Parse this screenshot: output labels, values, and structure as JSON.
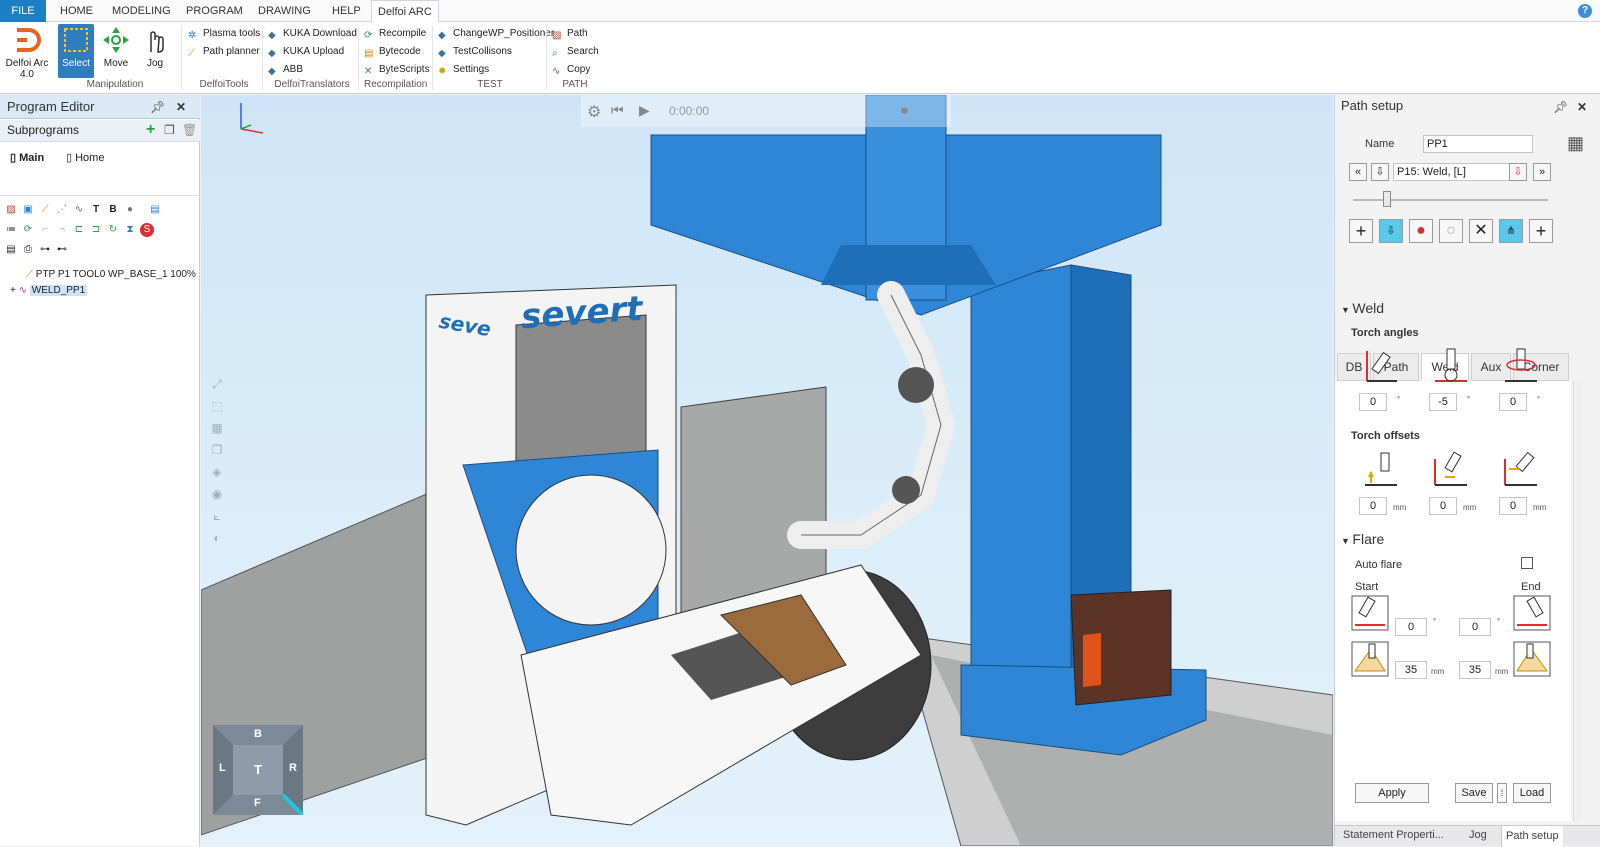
{
  "menu": {
    "file": "FILE",
    "items": [
      "HOME",
      "MODELING",
      "PROGRAM",
      "DRAWING",
      "HELP",
      "Delfoi ARC"
    ]
  },
  "ribbon": {
    "app_name": "Delfoi Arc",
    "app_version": "4.0",
    "select": "Select",
    "move": "Move",
    "jog": "Jog",
    "manipulation": "Manipulation",
    "plasma": "Plasma tools",
    "path_planner": "Path planner",
    "delfoitools": "DelfoiTools",
    "kuka_download": "KUKA Download",
    "kuka_upload": "KUKA Upload",
    "abb": "ABB",
    "delfoitranslators": "DelfoiTranslators",
    "recompile": "Recompile",
    "bytecode": "Bytecode",
    "bytescripts": "ByteScripts",
    "recompilation": "Recompilation",
    "changewp": "ChangeWP_Positioner",
    "testcollisons": "TestCollisons",
    "settings": "Settings",
    "test": "TEST",
    "path": "Path",
    "search": "Search",
    "copy": "Copy",
    "path_group": "PATH"
  },
  "program_editor": {
    "title": "Program Editor",
    "subprograms": "Subprograms",
    "main": "Main",
    "home": "Home",
    "tree": [
      {
        "label": "PTP P1 TOOL0 WP_BASE_1 100%"
      },
      {
        "label": "WELD_PP1"
      }
    ]
  },
  "viewport": {
    "timer": "0:00:00",
    "brand": "severt",
    "brand2": "seve",
    "cube": {
      "top": "B",
      "left": "L",
      "center": "T",
      "right": "R",
      "bottom": "F"
    }
  },
  "path_setup": {
    "title": "Path setup",
    "name_label": "Name",
    "name_value": "PP1",
    "point": "P15: Weld, [L]",
    "tabs": [
      "DB",
      "Path",
      "Weld",
      "Aux",
      "Corner"
    ],
    "weld": "Weld",
    "torch_angles": "Torch angles",
    "angles": [
      "0",
      "-5",
      "0"
    ],
    "deg": "°",
    "torch_offsets": "Torch offsets",
    "offsets": [
      "0",
      "0",
      "0"
    ],
    "mm": "mm",
    "flare": "Flare",
    "auto_flare": "Auto flare",
    "start": "Start",
    "end": "End",
    "flare_angles": [
      "0",
      "0"
    ],
    "flare_lengths": [
      "35",
      "35"
    ],
    "apply": "Apply",
    "save": "Save",
    "load": "Load",
    "bottom_tabs": [
      "Statement Properti...",
      "Jog",
      "Path setup"
    ]
  }
}
